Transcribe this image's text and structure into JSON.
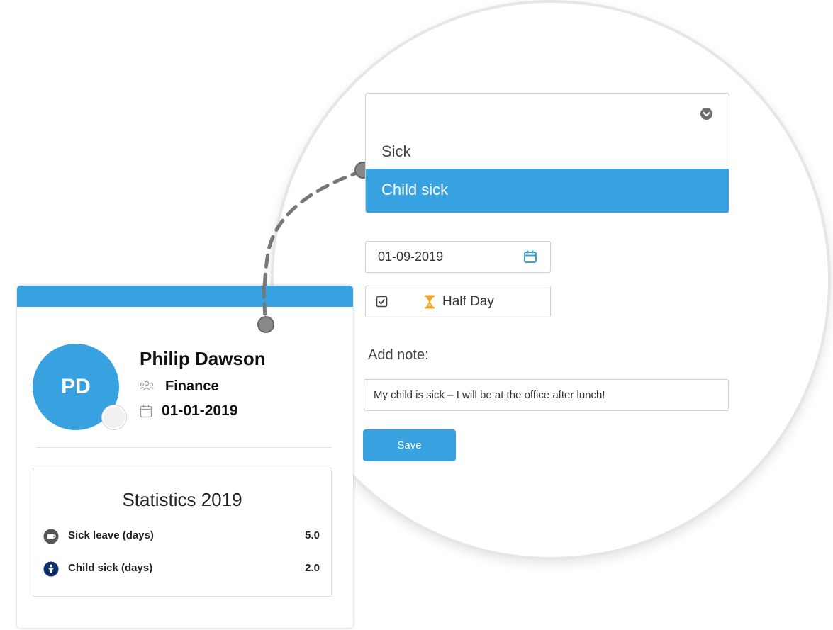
{
  "leave_form": {
    "dropdown": {
      "options": [
        "Sick",
        "Child sick"
      ],
      "selected": "Child sick",
      "chevron_icon": "chevron-down-circle-icon"
    },
    "date": {
      "value": "01-09-2019",
      "icon": "calendar-icon"
    },
    "half_day": {
      "label": "Half Day",
      "checkbox_icon": "checkbox-checked-icon",
      "icon": "hourglass-icon"
    },
    "note": {
      "label": "Add note:",
      "value": "My child is sick – I will be at the office after lunch!"
    },
    "save_label": "Save"
  },
  "profile": {
    "initials": "PD",
    "name": "Philip Dawson",
    "department": "Finance",
    "department_icon": "team-icon",
    "start_date": "01-01-2019",
    "start_date_icon": "calendar-icon"
  },
  "statistics": {
    "title": "Statistics 2019",
    "rows": [
      {
        "label": "Sick leave (days)",
        "value": "5.0",
        "icon": "sick-leave-icon"
      },
      {
        "label": "Child sick (days)",
        "value": "2.0",
        "icon": "child-icon"
      }
    ]
  },
  "colors": {
    "accent": "#38a2e0",
    "child_icon": "#0d2f6e",
    "sick_icon": "#555555",
    "hourglass": "#f5a623"
  }
}
